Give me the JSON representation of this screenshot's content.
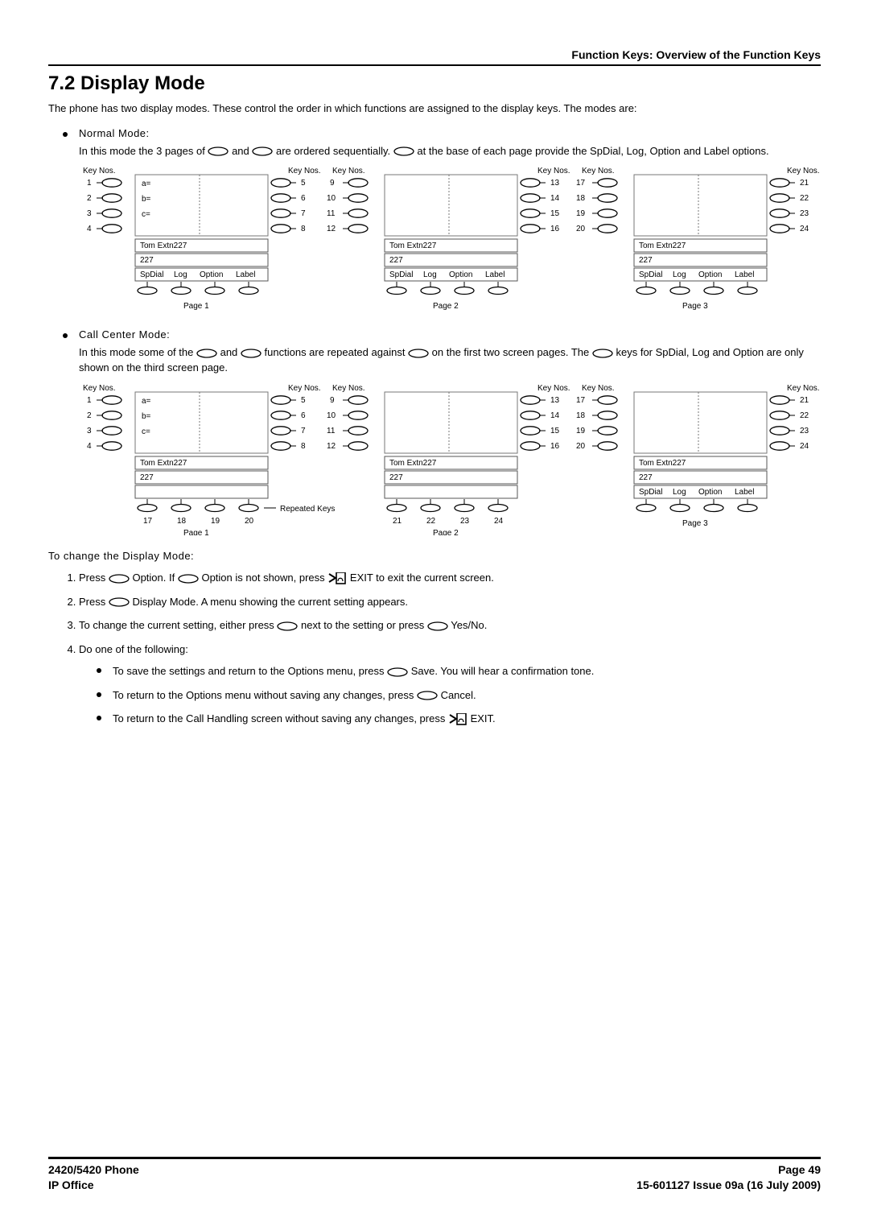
{
  "header": {
    "breadcrumb": "Function Keys: Overview of the Function Keys"
  },
  "title": "7.2 Display Mode",
  "intro": "The phone has two display modes. These control the order in which functions are assigned to the display keys. The modes are:",
  "normal_mode": {
    "name": "Normal Mode:",
    "desc_pre": "In this mode the 3 pages of ",
    "desc_mid": " and ",
    "desc_post1": " are ordered sequentially. ",
    "desc_post2": " at the base of each page provide the SpDial, Log, Option and Label options."
  },
  "call_center_mode": {
    "name": "Call Center Mode:",
    "desc_pre": "In this mode some of the ",
    "desc_mid": " and ",
    "desc_post1": " functions are repeated against ",
    "desc_post2": " on the first two screen pages. The ",
    "desc_post3": " keys for SpDial, Log and Option are only shown on the third screen page."
  },
  "diagram_labels": {
    "key_nos": "Key Nos.",
    "tom": "Tom Extn227",
    "extn": "227",
    "spdial": "SpDial",
    "log": "Log",
    "option": "Option",
    "label": "Label",
    "page1": "Page 1",
    "page2": "Page 2",
    "page3": "Page 3",
    "repeated": "Repeated Keys",
    "a": "a=",
    "b": "b=",
    "c": "c="
  },
  "steps_heading": "To change the Display Mode:",
  "steps": {
    "s1a": "Press ",
    "s1b": " Option. If ",
    "s1c": " Option is not shown, press ",
    "s1d": " EXIT to exit the current screen.",
    "s2a": "Press ",
    "s2b": " Display Mode. A menu showing the current setting appears.",
    "s3a": "To change the current setting, either press ",
    "s3b": " next to the setting or press ",
    "s3c": " Yes/No.",
    "s4": "Do one of the following:",
    "s4_1a": "To save the settings and return to the Options menu, press ",
    "s4_1b": " Save. You will hear a confirmation tone.",
    "s4_2a": "To return to the Options menu without saving any changes, press ",
    "s4_2b": " Cancel.",
    "s4_3a": "To return to the Call Handling screen without saving any changes, press ",
    "s4_3b": " EXIT."
  },
  "footer": {
    "left1": "2420/5420 Phone",
    "left2": "IP Office",
    "right1": "Page 49",
    "right2": "15-601127 Issue 09a (16 July 2009)"
  },
  "chart_data": [
    {
      "type": "table",
      "title": "Normal Mode key layout",
      "pages": [
        {
          "name": "Page 1",
          "left_keys": [
            1,
            2,
            3,
            4
          ],
          "left_labels": [
            "a=",
            "b=",
            "c=",
            ""
          ],
          "right_keys": [
            5,
            6,
            7,
            8
          ],
          "bottom_row": [
            "SpDial",
            "Log",
            "Option",
            "Label"
          ],
          "header": "Tom Extn227",
          "subheader": "227"
        },
        {
          "name": "Page 2",
          "left_keys": [
            9,
            10,
            11,
            12
          ],
          "right_keys": [
            13,
            14,
            15,
            16
          ],
          "bottom_row": [
            "SpDial",
            "Log",
            "Option",
            "Label"
          ],
          "header": "Tom Extn227",
          "subheader": "227"
        },
        {
          "name": "Page 3",
          "left_keys": [
            17,
            18,
            19,
            20
          ],
          "right_keys": [
            21,
            22,
            23,
            24
          ],
          "bottom_row": [
            "SpDial",
            "Log",
            "Option",
            "Label"
          ],
          "header": "Tom Extn227",
          "subheader": "227"
        }
      ]
    },
    {
      "type": "table",
      "title": "Call Center Mode key layout",
      "pages": [
        {
          "name": "Page 1",
          "left_keys": [
            1,
            2,
            3,
            4
          ],
          "left_labels": [
            "a=",
            "b=",
            "c=",
            ""
          ],
          "right_keys": [
            5,
            6,
            7,
            8
          ],
          "bottom_keys": [
            17,
            18,
            19,
            20
          ],
          "bottom_note": "Repeated Keys",
          "header": "Tom Extn227",
          "subheader": "227"
        },
        {
          "name": "Page 2",
          "left_keys": [
            9,
            10,
            11,
            12
          ],
          "right_keys": [
            13,
            14,
            15,
            16
          ],
          "bottom_keys": [
            21,
            22,
            23,
            24
          ],
          "header": "Tom Extn227",
          "subheader": "227"
        },
        {
          "name": "Page 3",
          "left_keys": [
            17,
            18,
            19,
            20
          ],
          "right_keys": [
            21,
            22,
            23,
            24
          ],
          "bottom_row": [
            "SpDial",
            "Log",
            "Option",
            "Label"
          ],
          "header": "Tom Extn227",
          "subheader": "227"
        }
      ]
    }
  ]
}
